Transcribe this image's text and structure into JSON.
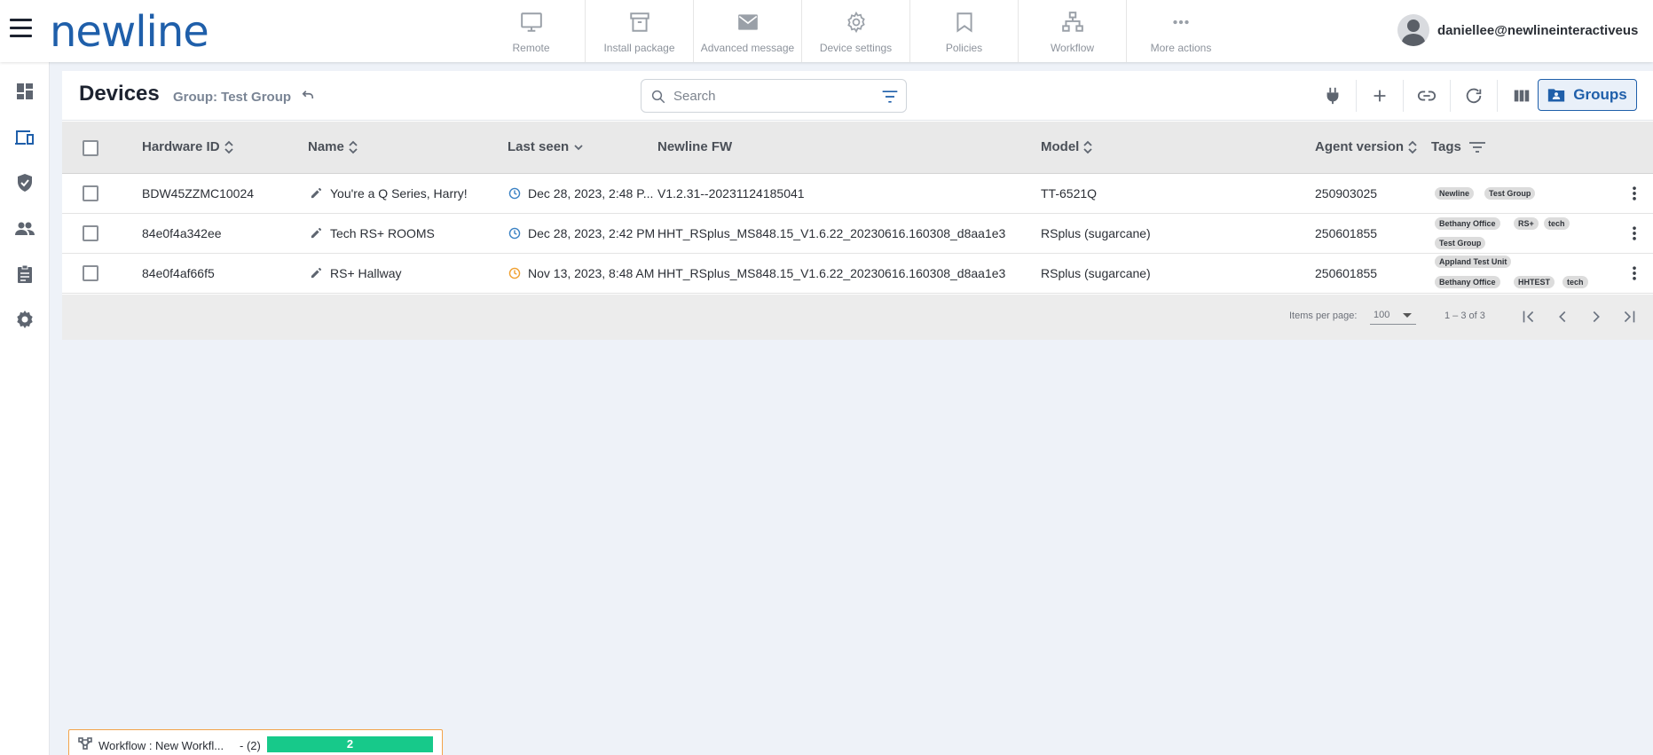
{
  "app": {
    "logo": "newline",
    "user_email": "daniellee@newlineinteractiveus"
  },
  "top_actions": [
    {
      "label": "Remote",
      "icon": "monitor-icon"
    },
    {
      "label": "Install package",
      "icon": "archive-box-icon"
    },
    {
      "label": "Advanced message",
      "icon": "envelope-icon"
    },
    {
      "label": "Device settings",
      "icon": "gear-icon"
    },
    {
      "label": "Policies",
      "icon": "bookmark-icon"
    },
    {
      "label": "Workflow",
      "icon": "sitemap-icon"
    },
    {
      "label": "More actions",
      "icon": "ellipsis-icon"
    }
  ],
  "sidebar": {
    "items": [
      {
        "name": "dashboard",
        "icon": "dashboard-icon",
        "active": false
      },
      {
        "name": "devices",
        "icon": "devices-icon",
        "active": true
      },
      {
        "name": "security",
        "icon": "shield-check-icon",
        "active": false
      },
      {
        "name": "users",
        "icon": "people-icon",
        "active": false
      },
      {
        "name": "reports",
        "icon": "clipboard-icon",
        "active": false
      },
      {
        "name": "settings",
        "icon": "gear-icon",
        "active": false
      }
    ]
  },
  "page": {
    "title": "Devices",
    "group_label": "Group: Test Group",
    "search_placeholder": "Search",
    "groups_button": "Groups"
  },
  "table": {
    "columns": [
      "Hardware ID",
      "Name",
      "Last seen",
      "Newline FW",
      "Model",
      "Agent version",
      "Tags"
    ],
    "rows": [
      {
        "hardware_id": "BDW45ZZMC10024",
        "name": "You're a Q Series, Harry!",
        "last_seen": "Dec 28, 2023, 2:48 P...",
        "last_seen_status": "recent",
        "fw": "V1.2.31--20231124185041",
        "model": "TT-6521Q",
        "agent_version": "250903025",
        "tags": [
          "Newline",
          "Test Group"
        ]
      },
      {
        "hardware_id": "84e0f4a342ee",
        "name": "Tech RS+ ROOMS",
        "last_seen": "Dec 28, 2023, 2:42 PM",
        "last_seen_status": "recent",
        "fw": "HHT_RSplus_MS848.15_V1.6.22_20230616.160308_d8aa1e3",
        "model": "RSplus (sugarcane)",
        "agent_version": "250601855",
        "tags": [
          "Bethany Office",
          "RS+",
          "tech",
          "Test Group"
        ]
      },
      {
        "hardware_id": "84e0f4af66f5",
        "name": "RS+ Hallway",
        "last_seen": "Nov 13, 2023, 8:48 AM",
        "last_seen_status": "stale",
        "fw": "HHT_RSplus_MS848.15_V1.6.22_20230616.160308_d8aa1e3",
        "model": "RSplus (sugarcane)",
        "agent_version": "250601855",
        "tags": [
          "Appland Test Unit",
          "Bethany Office",
          "HHTEST",
          "tech"
        ]
      }
    ]
  },
  "pagination": {
    "items_per_page_label": "Items per page:",
    "items_per_page": "100",
    "range": "1 – 3 of 3"
  },
  "workflow": {
    "label": "Workflow : New Workfl...",
    "count": "- (2)",
    "progress_value": "2"
  },
  "colors": {
    "brand": "#1f5faa",
    "clock_recent": "#3b82c4",
    "clock_stale": "#f0a030",
    "progress": "#17c98a",
    "workflow_border": "#f3a44a"
  }
}
